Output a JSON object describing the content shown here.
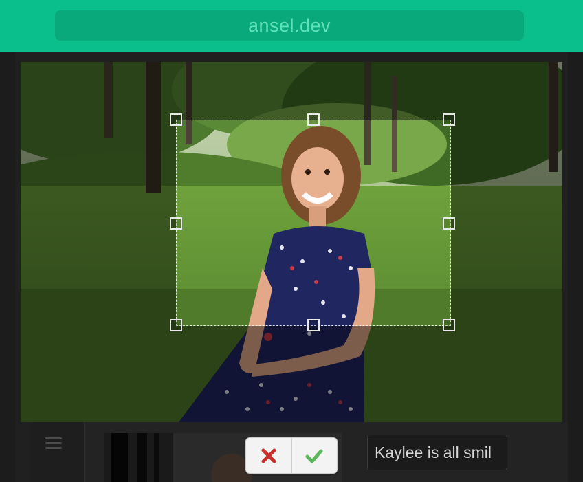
{
  "browser": {
    "url": "ansel.dev"
  },
  "crop_editor": {
    "cancel_icon": "x-icon",
    "confirm_icon": "check-icon",
    "colors": {
      "cancel": "#c9302c",
      "confirm": "#5cb85c",
      "brand": "#0abf8c"
    }
  },
  "sidebar": {
    "menu_icon": "hamburger-icon"
  },
  "caption": {
    "value": "Kaylee is all smil"
  }
}
